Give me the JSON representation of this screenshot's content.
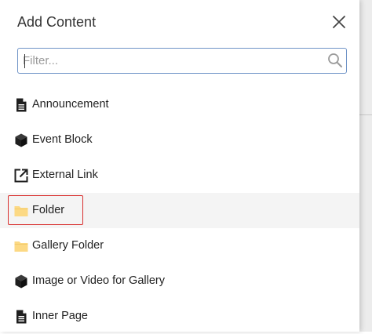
{
  "dialog": {
    "title": "Add Content",
    "filter_placeholder": "Filter...",
    "filter_value": ""
  },
  "items": [
    {
      "label": "Announcement",
      "icon": "document-icon"
    },
    {
      "label": "Event Block",
      "icon": "cube-icon"
    },
    {
      "label": "External Link",
      "icon": "external-link-icon"
    },
    {
      "label": "Folder",
      "icon": "folder-icon",
      "highlighted": true
    },
    {
      "label": "Gallery Folder",
      "icon": "folder-icon"
    },
    {
      "label": "Image or Video for Gallery",
      "icon": "cube-icon"
    },
    {
      "label": "Inner Page",
      "icon": "document-icon"
    }
  ],
  "colors": {
    "folder": "#fcd984",
    "icon_dark": "#1f1f1f",
    "search_border": "#6f93c7",
    "selection_outline": "#d9302f"
  }
}
